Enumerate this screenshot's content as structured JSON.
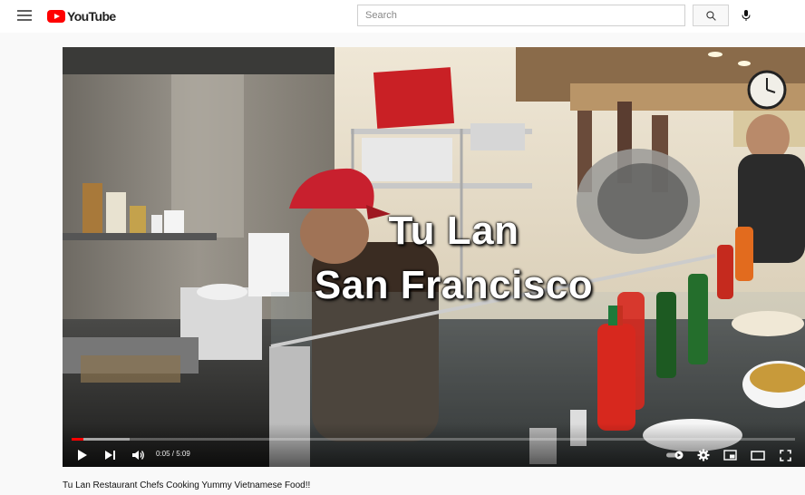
{
  "app": {
    "logo_text": "YouTube",
    "brand_color": "#ff0000"
  },
  "header": {
    "search": {
      "placeholder": "Search",
      "value": ""
    },
    "icons": [
      "menu-icon",
      "search-icon",
      "microphone-icon"
    ]
  },
  "player": {
    "overlay_title_line1": "Tu Lan",
    "overlay_title_line2": "San Francisco",
    "time_current": "0:05",
    "time_separator": " / ",
    "time_total": "5:09",
    "progress_fraction": 0.016,
    "buffered_fraction": 0.08,
    "controls": [
      "play-icon",
      "next-icon",
      "volume-icon",
      "autoplay-toggle-icon",
      "settings-icon",
      "miniplayer-icon",
      "theater-mode-icon",
      "fullscreen-icon"
    ]
  },
  "video": {
    "title": "Tu Lan Restaurant Chefs Cooking Yummy Vietnamese Food!!"
  }
}
